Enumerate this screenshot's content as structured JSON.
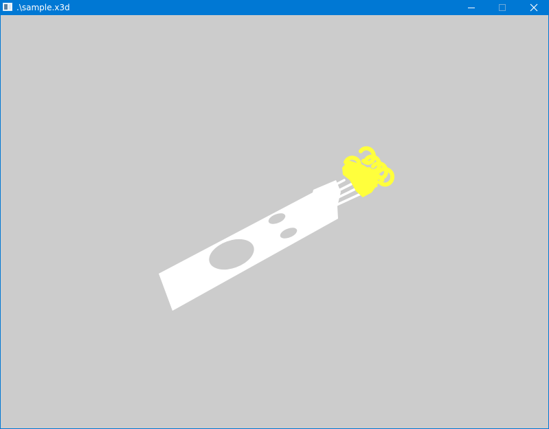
{
  "window": {
    "title": ".\\sample.x3d",
    "background_color": "#cccccc",
    "titlebar_color": "#0078d4",
    "controls": [
      "minimize-icon",
      "maximize-icon",
      "close-icon"
    ]
  },
  "scene": {
    "board_color": "#ffffff",
    "connector_color": "#ffff3c"
  }
}
